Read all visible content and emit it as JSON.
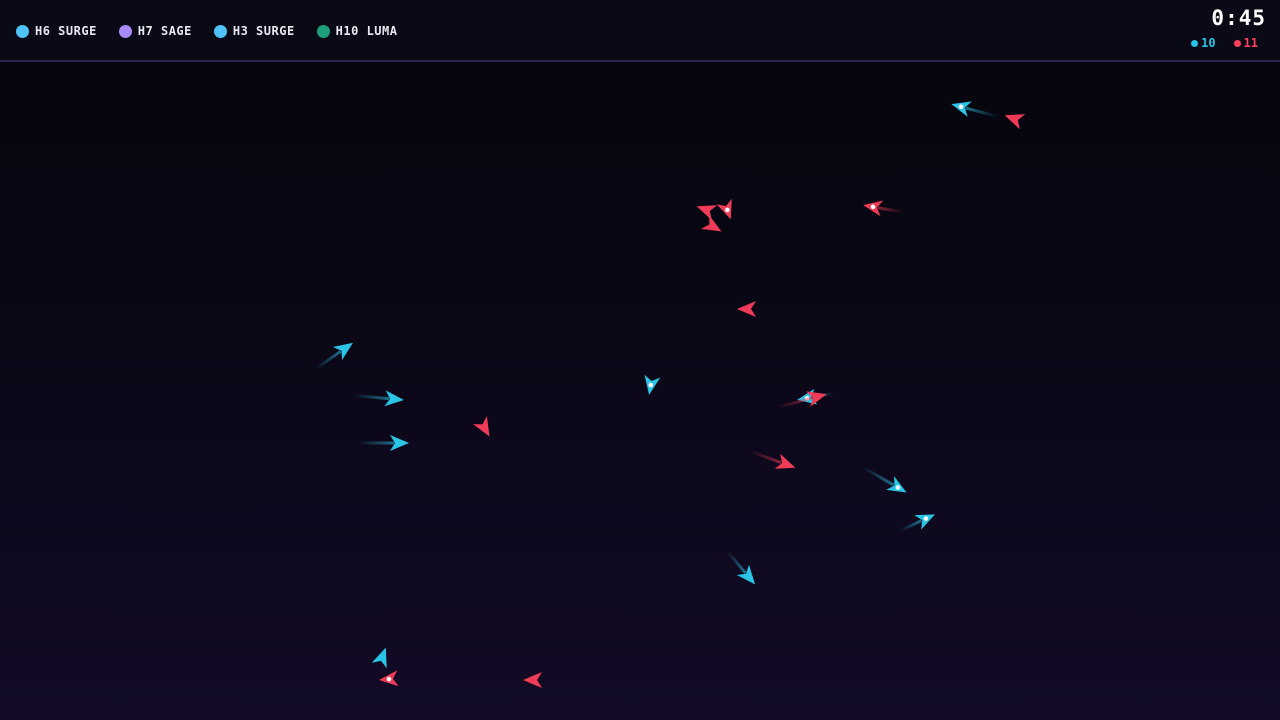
{
  "hud": {
    "roster": [
      {
        "label": "H6 SURGE",
        "color": "#4fc3f7"
      },
      {
        "label": "H7 SAGE",
        "color": "#a78bfa"
      },
      {
        "label": "H3 SURGE",
        "color": "#4fc3f7"
      },
      {
        "label": "H10 LUMA",
        "color": "#1f9e7a"
      }
    ],
    "timer": "0:45",
    "score": {
      "cyan": {
        "value": "10",
        "color": "#29c4e6"
      },
      "red": {
        "value": "11",
        "color": "#ff3f5e"
      }
    }
  },
  "colors": {
    "cyan_team": "#29c4e6",
    "red_team": "#f03b57",
    "hud_border": "#2d2550"
  }
}
